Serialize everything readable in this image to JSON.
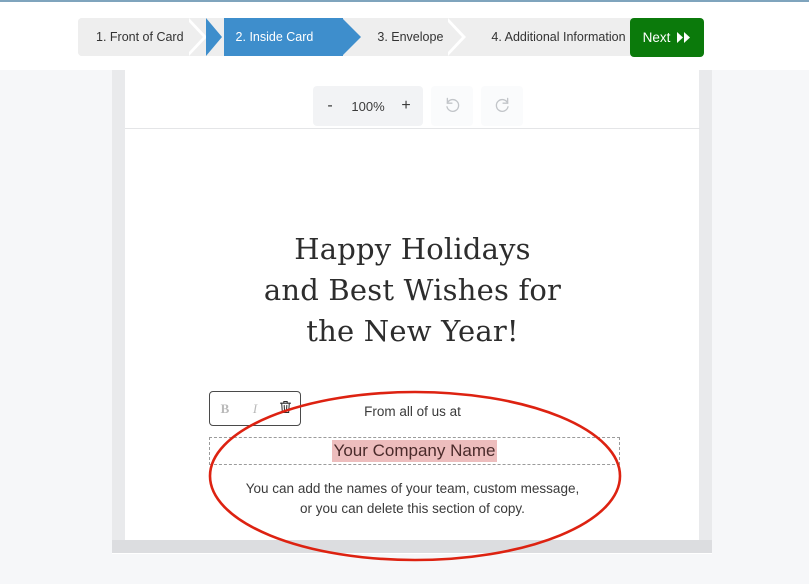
{
  "header": {
    "steps": [
      {
        "label": "1. Front of Card",
        "active": false
      },
      {
        "label": "2. Inside Card",
        "active": true
      },
      {
        "label": "3. Envelope",
        "active": false
      },
      {
        "label": "4. Additional Information",
        "active": false
      }
    ],
    "next_label": "Next",
    "next_icon": "fast-forward-icon",
    "active_step_color": "#3e8ecc",
    "next_button_color": "#0b7a0b"
  },
  "toolbar": {
    "zoom_out_label": "-",
    "zoom_level": "100%",
    "zoom_in_label": "+",
    "undo_icon": "undo-icon",
    "redo_icon": "redo-icon"
  },
  "card": {
    "headline_line1": "Happy Holidays",
    "headline_line2": "and Best Wishes for",
    "headline_line3": "the New Year!",
    "signoff": "From all of us at",
    "company_name": "Your Company Name",
    "company_name_highlight": "#edbdbd",
    "body_line1": "You can add the names of your team, custom message,",
    "body_line2": "or you can delete this section of copy."
  },
  "text_toolbar": {
    "bold_label": "B",
    "italic_label": "I",
    "delete_icon": "trash-icon"
  },
  "annotation": {
    "shape": "ellipse",
    "color": "#dd2211"
  }
}
